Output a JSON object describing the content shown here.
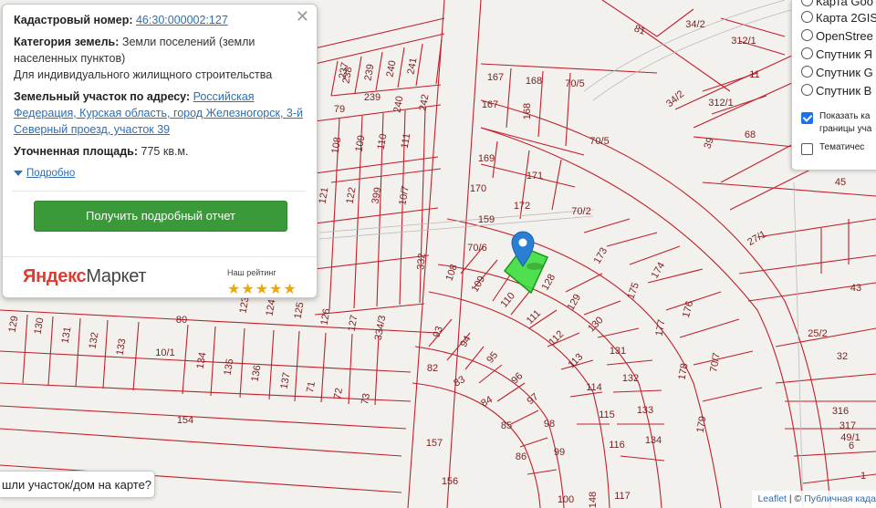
{
  "popup": {
    "cadastral_label": "Кадастровый номер:",
    "cadastral_number": "46:30:000002:127",
    "category_label": "Категория земель:",
    "category_value": "Земли поселений (земли населенных пунктов)",
    "use_value": "Для индивидуального жилищного строительства",
    "address_label": "Земельный участок по адресу:",
    "address_value": "Российская Федерация, Курская область, город Железногорск, 3-й Северный проезд, участок 39",
    "area_label": "Уточненная площадь:",
    "area_value": "775 кв.м.",
    "details_link": "Подробно",
    "report_button": "Получить подробный отчет",
    "ym_logo_y": "Яндекс",
    "ym_logo_m": "Маркет",
    "rating_label": "Наш рейтинг",
    "stars": "★★★★★"
  },
  "layers": {
    "options": [
      "Карта Goo",
      "Карта 2GIS",
      "OpenStree",
      "Спутник Я",
      "Спутник G",
      "Спутник B"
    ],
    "overlay_checkbox_line1": "Показать ка",
    "overlay_checkbox_line2": "границы уча",
    "thematic_checkbox": "Тематичес"
  },
  "ask_button": "шли участок/дом на карте?",
  "attribution": {
    "leaflet": "Leaflet",
    "separator": "| ©",
    "source": "Публичная када"
  },
  "colors": {
    "parcel_line": "#c0202a",
    "selected_parcel": "#33dd33",
    "marker": "#2a7fd4",
    "button": "#3a9a3a"
  },
  "parcel_labels": [
    "237",
    "238",
    "239",
    "240",
    "241",
    "239",
    "240",
    "242",
    "79",
    "108",
    "109",
    "110",
    "111",
    "121",
    "122",
    "399",
    "10/7",
    "167",
    "168",
    "70/5",
    "167",
    "168",
    "70/5",
    "169",
    "171",
    "170",
    "172",
    "70/2",
    "159",
    "70/6",
    "173",
    "174",
    "175",
    "176",
    "177",
    "70/7",
    "178",
    "179",
    "108",
    "109",
    "110",
    "128",
    "129",
    "130",
    "111",
    "112",
    "131",
    "113",
    "114",
    "132",
    "133",
    "115",
    "116",
    "134",
    "93",
    "94",
    "95",
    "82",
    "83",
    "84",
    "96",
    "97",
    "85",
    "98",
    "86",
    "99",
    "157",
    "156",
    "117",
    "100",
    "148",
    "332",
    "80",
    "129",
    "130",
    "131",
    "132",
    "133",
    "10/1",
    "134",
    "135",
    "136",
    "137",
    "71",
    "72",
    "73",
    "123",
    "124",
    "125",
    "126",
    "127",
    "334/3",
    "154",
    "81",
    "34/2",
    "312/1",
    "34/2",
    "312/1",
    "11",
    "39",
    "68",
    "45",
    "27/1",
    "43",
    "25/2",
    "32",
    "316",
    "317",
    "49/1",
    "6",
    "1"
  ]
}
